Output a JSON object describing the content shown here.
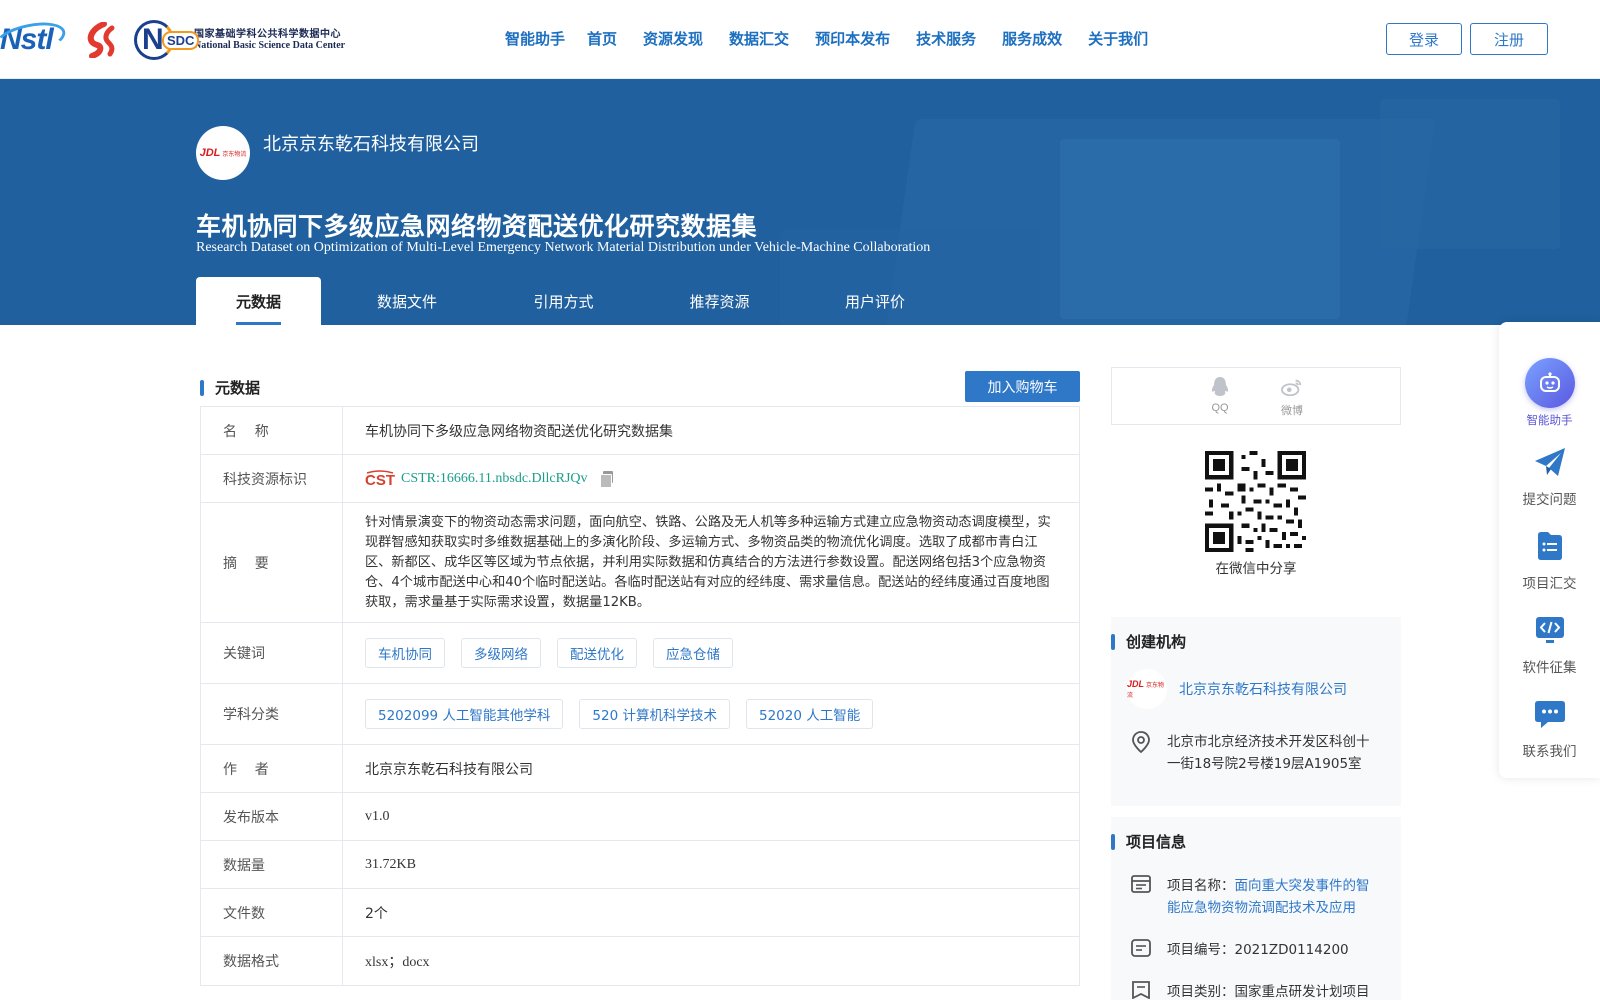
{
  "header": {
    "logos": [
      "nstl-logo",
      "s-logo",
      "nsdc-logo"
    ],
    "nsdc_logo_cn": "国家基础学科公共科学数据中心",
    "nsdc_logo_en": "National Basic Science Data Center",
    "nav": [
      "智能助手",
      "首页",
      "资源发现",
      "数据汇交",
      "预印本发布",
      "技术服务",
      "服务成效",
      "关于我们"
    ],
    "login_label": "登录",
    "register_label": "注册",
    "accent_color": "#1d6fc0"
  },
  "banner": {
    "org_name": "北京京东乾石科技有限公司",
    "title": "车机协同下多级应急网络物资配送优化研究数据集",
    "title_en": "Research Dataset on Optimization of Multi-Level Emergency Network Material Distribution under Vehicle-Machine Collaboration",
    "tabs": [
      "元数据",
      "数据文件",
      "引用方式",
      "推荐资源",
      "用户评价"
    ],
    "active_tab": "元数据",
    "bg_color": "#20609e"
  },
  "metadata": {
    "section_title": "元数据",
    "cart_label": "加入购物车",
    "rows": {
      "name": {
        "label": "名    称",
        "value": "车机协同下多级应急网络物资配送优化研究数据集"
      },
      "cstr": {
        "label": "科技资源标识",
        "value": "CSTR:16666.11.nbsdc.DllcRJQv",
        "logo": "CSTR"
      },
      "abstract": {
        "label": "摘    要",
        "value": "针对情景演变下的物资动态需求问题，面向航空、铁路、公路及无人机等多种运输方式建立应急物资动态调度模型，实现群智感知获取实时多维数据基础上的多演化阶段、多运输方式、多物资品类的物流优化调度。选取了成都市青白江区、新都区、成华区等区域为节点依据，并利用实际数据和仿真结合的方法进行参数设置。配送网络包括3个应急物资仓、4个城市配送中心和40个临时配送站。各临时配送站有对应的经纬度、需求量信息。配送站的经纬度通过百度地图获取，需求量基于实际需求设置，数据量12KB。"
      },
      "keywords": {
        "label": "关键词",
        "tags": [
          "车机协同",
          "多级网络",
          "配送优化",
          "应急仓储"
        ]
      },
      "subjects": {
        "label": "学科分类",
        "tags": [
          "5202099 人工智能其他学科",
          "520 计算机科学技术",
          "52020 人工智能"
        ]
      },
      "author": {
        "label": "作    者",
        "value": "北京京东乾石科技有限公司"
      },
      "version": {
        "label": "发布版本",
        "value": "v1.0"
      },
      "size": {
        "label": "数据量",
        "value": "31.72KB"
      },
      "files": {
        "label": "文件数",
        "value": "2个"
      },
      "format": {
        "label": "数据格式",
        "value": "xlsx；docx"
      }
    }
  },
  "sidebar": {
    "share": [
      {
        "label": "QQ",
        "icon": "qq-icon"
      },
      {
        "label": "微博",
        "icon": "weibo-icon"
      }
    ],
    "qr_label": "在微信中分享",
    "org_section": {
      "title": "创建机构",
      "name": "北京京东乾石科技有限公司",
      "address": "北京市北京经济技术开发区科创十一街18号院2号楼19层A1905室"
    },
    "project_section": {
      "title": "项目信息",
      "name_label": "项目名称：",
      "name_value": "面向重大突发事件的智能应急物资物流调配技术及应用",
      "code_label": "项目编号：",
      "code_value": "2021ZD0114200",
      "type_label": "项目类别：",
      "type_value": "国家重点研发计划项目"
    }
  },
  "float_toolbar": {
    "items": [
      {
        "label": "智能助手",
        "icon": "robot-icon"
      },
      {
        "label": "提交问题",
        "icon": "paper-plane-icon"
      },
      {
        "label": "项目汇交",
        "icon": "list-doc-icon"
      },
      {
        "label": "软件征集",
        "icon": "code-icon"
      },
      {
        "label": "联系我们",
        "icon": "chat-icon"
      }
    ]
  }
}
